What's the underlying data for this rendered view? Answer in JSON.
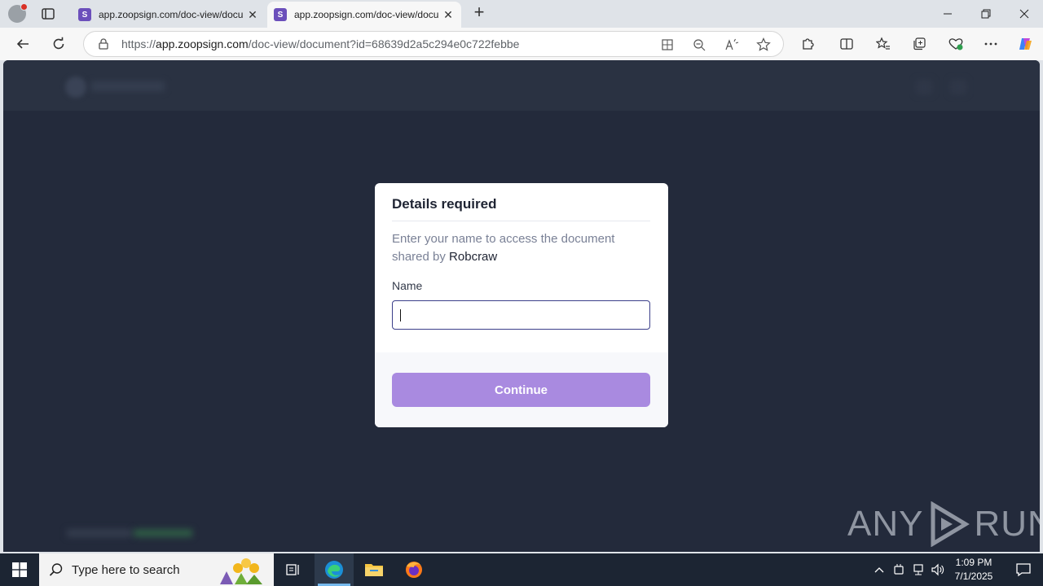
{
  "browser": {
    "tabs": [
      {
        "title": "app.zoopsign.com/doc-view/docu",
        "active": false
      },
      {
        "title": "app.zoopsign.com/doc-view/docu",
        "active": true
      }
    ],
    "new_tab_label": "+",
    "url_prefix": "https://",
    "url_host": "app.zoopsign.com",
    "url_path": "/doc-view/document?id=68639d2a5c294e0c722febbe"
  },
  "modal": {
    "title": "Details required",
    "description": "Enter your name to access the document shared by",
    "owner": "Robcraw",
    "name_label": "Name",
    "name_value": "",
    "continue_label": "Continue"
  },
  "watermark": {
    "left": "ANY",
    "right": "RUN"
  },
  "taskbar": {
    "search_placeholder": "Type here to search",
    "time": "1:09 PM",
    "date": "7/1/2025"
  },
  "colors": {
    "page_bg": "#232a3b",
    "accent": "#a98ae0",
    "input_border": "#3b3f8a"
  }
}
